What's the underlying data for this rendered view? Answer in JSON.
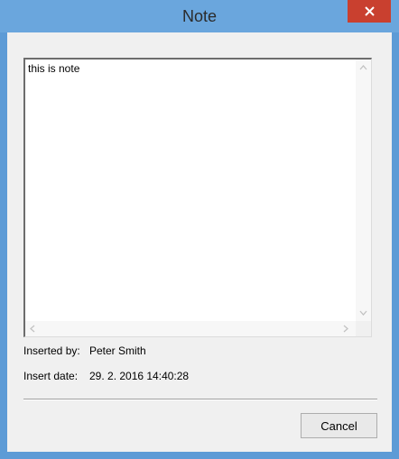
{
  "window": {
    "title": "Note",
    "close_icon": "close-icon"
  },
  "editor": {
    "text": "this is note",
    "scroll_up_icon": "chevron-up-icon",
    "scroll_down_icon": "chevron-down-icon",
    "scroll_left_icon": "chevron-left-icon",
    "scroll_right_icon": "chevron-right-icon"
  },
  "info": {
    "inserted_by_label": "Inserted by:",
    "inserted_by_value": "Peter Smith",
    "insert_date_label": "Insert date:",
    "insert_date_value": "29. 2. 2016 14:40:28"
  },
  "buttons": {
    "cancel_label": "Cancel"
  },
  "colors": {
    "titlebar": "#6aa6dd",
    "close_button": "#c9402f",
    "dialog_background": "#f0f0f0"
  }
}
